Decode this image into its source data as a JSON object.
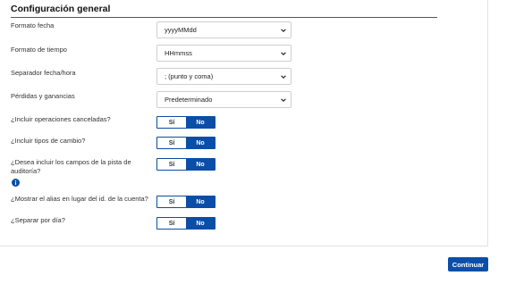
{
  "section": {
    "title": "Configuración general"
  },
  "fields": {
    "date_format": {
      "label": "Formato fecha",
      "value": "yyyyMMdd"
    },
    "time_format": {
      "label": "Formato de tiempo",
      "value": "HHmmss"
    },
    "datetime_separator": {
      "label": "Separador fecha/hora",
      "value": "; (punto y coma)"
    },
    "pnl": {
      "label": "Pérdidas y ganancias",
      "value": "Predeterminado"
    }
  },
  "toggles": {
    "cancelled_ops": {
      "label": "¿Incluir operaciones canceladas?",
      "yes": "Sí",
      "no": "No",
      "selected": "No"
    },
    "exchange_rates": {
      "label": "¿Incluir tipos de cambio?",
      "yes": "Sí",
      "no": "No",
      "selected": "No"
    },
    "audit_trail": {
      "label_line1": "¿Desea incluir los campos de la pista de",
      "label_line2": "auditoría?",
      "yes": "Sí",
      "no": "No",
      "selected": "No"
    },
    "account_alias": {
      "label": "¿Mostrar el alias en lugar del id. de la cuenta?",
      "yes": "Sí",
      "no": "No",
      "selected": "No"
    },
    "split_by_day": {
      "label": "¿Separar por día?",
      "yes": "Sí",
      "no": "No",
      "selected": "No"
    }
  },
  "icons": {
    "info": "info-icon",
    "chevron": "chevron-down-icon"
  },
  "colors": {
    "accent": "#0b4ea8"
  },
  "footer": {
    "continue_label": "Continuar"
  }
}
